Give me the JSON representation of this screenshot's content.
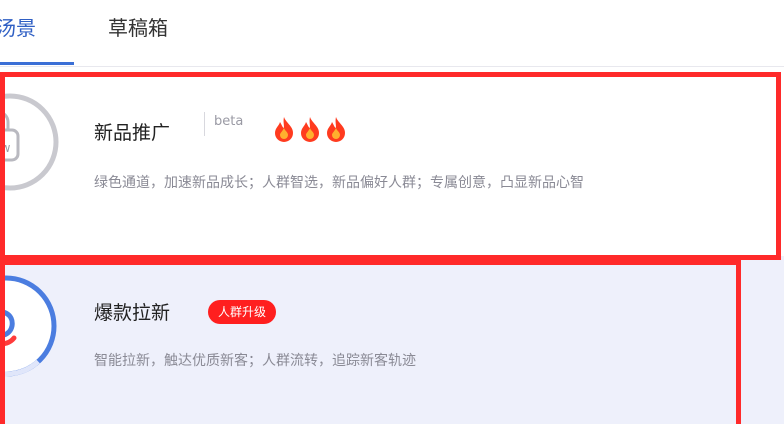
{
  "tabs": [
    {
      "label": "场景",
      "visible_label": "汤景",
      "active": true
    },
    {
      "label": "草稿箱",
      "active": false
    }
  ],
  "cards": [
    {
      "title": "新品推广",
      "beta": "beta",
      "icon_text": "new",
      "flame_count": 3,
      "description": "绿色通道，加速新品成长；人群智选，新品偏好人群；专属创意，凸显新品心智"
    },
    {
      "title": "爆款拉新",
      "badge": "人群升级",
      "description": "智能拉新，触达优质新客；人群流转，追踪新客轨迹"
    }
  ],
  "colors": {
    "accent": "#3b6fd6",
    "highlight_outline": "#ff2a2a",
    "badge": "#ff1f1f",
    "flame": "#ff3b1f"
  },
  "icons": [
    "bag-icon",
    "flame-icon",
    "swirl-logo-icon"
  ]
}
